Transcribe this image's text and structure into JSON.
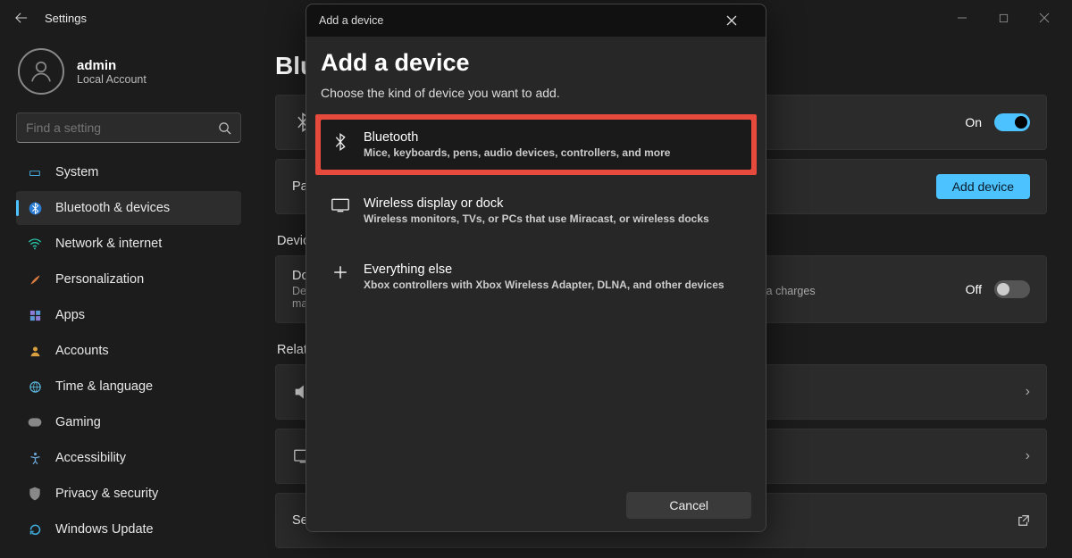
{
  "window": {
    "title": "Settings"
  },
  "profile": {
    "name": "admin",
    "sub": "Local Account"
  },
  "search": {
    "placeholder": "Find a setting"
  },
  "nav": {
    "items": [
      {
        "label": "System"
      },
      {
        "label": "Bluetooth & devices"
      },
      {
        "label": "Network & internet"
      },
      {
        "label": "Personalization"
      },
      {
        "label": "Apps"
      },
      {
        "label": "Accounts"
      },
      {
        "label": "Time & language"
      },
      {
        "label": "Gaming"
      },
      {
        "label": "Accessibility"
      },
      {
        "label": "Privacy & security"
      },
      {
        "label": "Windows Update"
      }
    ]
  },
  "page": {
    "title_prefix": "Blu",
    "bluetooth_card": {
      "state_label": "On"
    },
    "paired_label_prefix": "Pai",
    "add_device_button": "Add device",
    "device_label_prefix": "Device",
    "download_card": {
      "t1_prefix": "Dow",
      "t2_line1": "Devi",
      "t2_line2": "may",
      "t2_hint": "onnections—data charges",
      "state_label": "Off"
    },
    "related_label": "Related",
    "send_files": "Send or receive files via Bluetooth"
  },
  "modal": {
    "titlebar": "Add a device",
    "heading": "Add a device",
    "sub": "Choose the kind of device you want to add.",
    "options": [
      {
        "title": "Bluetooth",
        "desc": "Mice, keyboards, pens, audio devices, controllers, and more"
      },
      {
        "title": "Wireless display or dock",
        "desc": "Wireless monitors, TVs, or PCs that use Miracast, or wireless docks"
      },
      {
        "title": "Everything else",
        "desc": "Xbox controllers with Xbox Wireless Adapter, DLNA, and other devices"
      }
    ],
    "cancel": "Cancel"
  }
}
